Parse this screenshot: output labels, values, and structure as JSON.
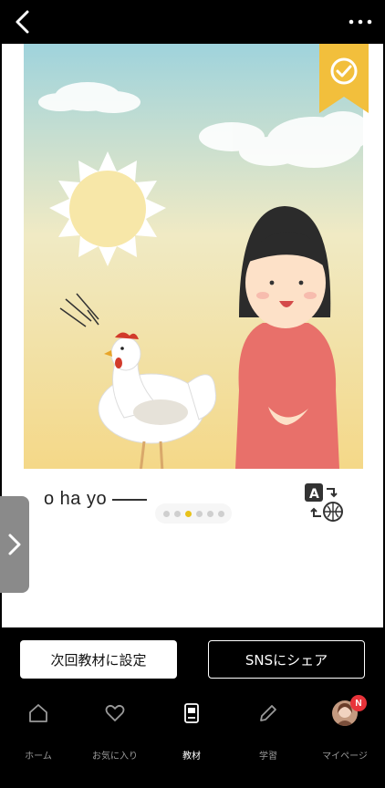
{
  "header": {
    "back_icon": "chevron-left-icon",
    "more_icon": "more-horizontal-icon"
  },
  "lesson": {
    "completed_icon": "check-badge-icon",
    "phrase": "o ha yo",
    "translate_icon": "translate-icon",
    "slides_total": 6,
    "slide_current": 3,
    "next_icon": "chevron-right-icon"
  },
  "actions": {
    "set_next_label": "次回教材に設定",
    "share_label": "SNSにシェア"
  },
  "tabs": [
    {
      "label": "ホーム",
      "icon": "home-icon"
    },
    {
      "label": "お気に入り",
      "icon": "heart-icon"
    },
    {
      "label": "教材",
      "icon": "book-icon"
    },
    {
      "label": "学習",
      "icon": "pencil-icon"
    },
    {
      "label": "マイページ",
      "icon": "avatar",
      "badge": "N"
    }
  ],
  "colors": {
    "accent_yellow": "#f2bf3c",
    "active_dot": "#e8c21a",
    "badge_red": "#e8333a"
  }
}
